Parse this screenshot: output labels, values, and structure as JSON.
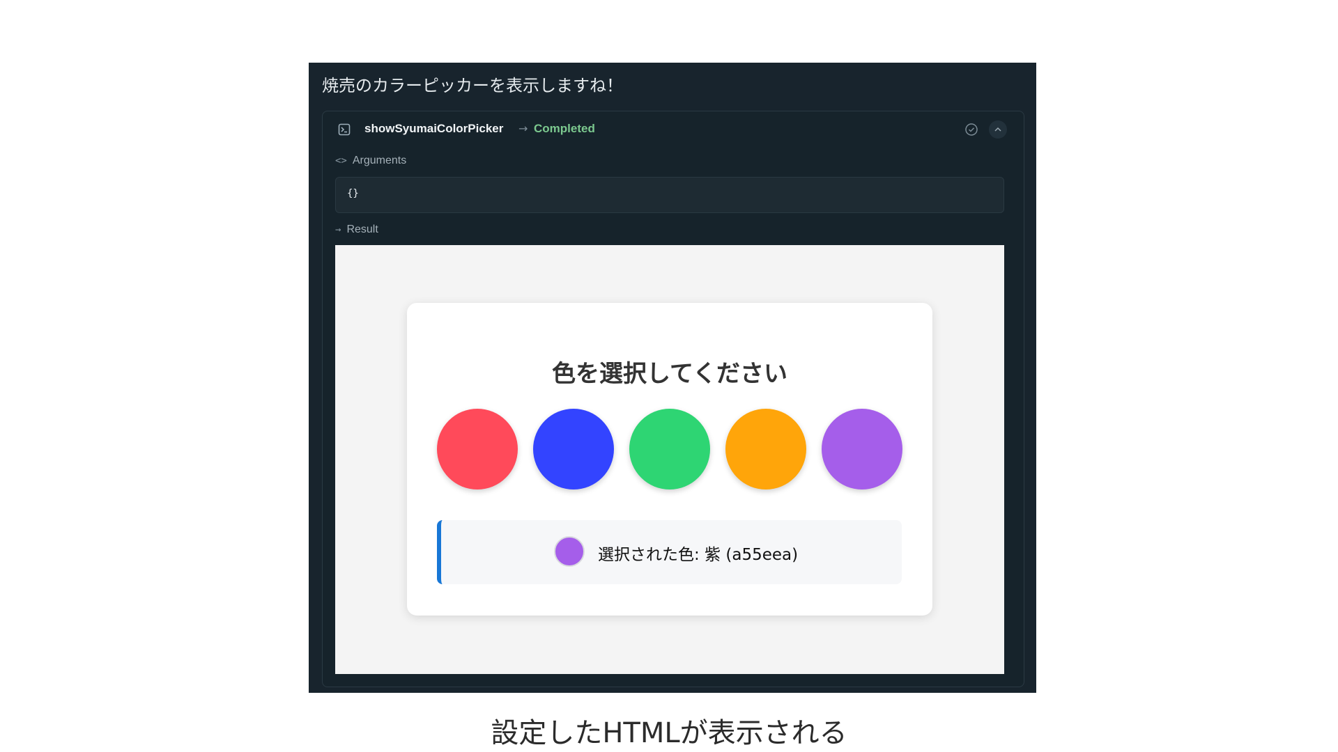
{
  "chat": {
    "assistant_message": "焼売のカラーピッカーを表示しますね！"
  },
  "tool_call": {
    "name": "showSyumaiColorPicker",
    "arrow": "→",
    "status": "Completed",
    "status_color": "#7cc98f",
    "icons": {
      "tool": "terminal-icon",
      "status": "check-circle-icon",
      "collapse": "chevron-up-icon"
    },
    "arguments_label": "Arguments",
    "arguments_glyph": "<>",
    "arguments_value": "{}",
    "result_label": "Result",
    "result_glyph": "→"
  },
  "picker": {
    "title": "色を選択してください",
    "swatches": [
      {
        "color": "#ff4a5a"
      },
      {
        "color": "#3344ff"
      },
      {
        "color": "#2ed573"
      },
      {
        "color": "#ffa50a"
      },
      {
        "color": "#a55eea"
      }
    ],
    "selected_color": "#a55eea",
    "selected_text": "選択された色: 紫 (a55eea)",
    "accent_color": "#1877d6"
  },
  "caption": "設定したHTMLが表示される"
}
